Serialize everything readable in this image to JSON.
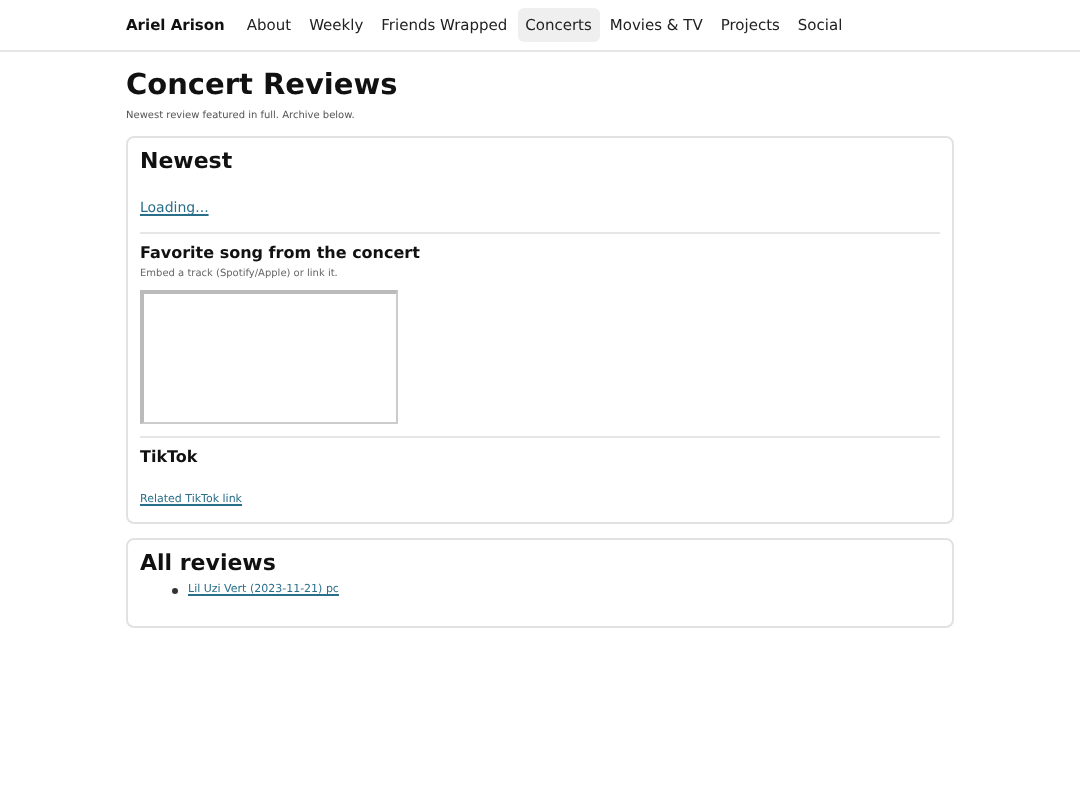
{
  "nav": {
    "brand": "Ariel Arison",
    "items": [
      {
        "label": "About",
        "selected": false
      },
      {
        "label": "Weekly",
        "selected": false
      },
      {
        "label": "Friends Wrapped",
        "selected": false
      },
      {
        "label": "Concerts",
        "selected": true
      },
      {
        "label": "Movies & TV",
        "selected": false
      },
      {
        "label": "Projects",
        "selected": false
      },
      {
        "label": "Social",
        "selected": false
      }
    ]
  },
  "page": {
    "title": "Concert Reviews",
    "subtitle": "Newest review featured in full. Archive below."
  },
  "newest": {
    "heading": "Newest",
    "link": "Loading...",
    "song_heading": "Favorite song from the concert",
    "song_hint": "Embed a track (Spotify/Apple) or link it.",
    "tiktok_heading": "TikTok",
    "tiktok_link": "Related TikTok link"
  },
  "all_reviews": {
    "heading": "All reviews",
    "items": [
      "Lil Uzi Vert (2023-11-21) pc"
    ]
  }
}
